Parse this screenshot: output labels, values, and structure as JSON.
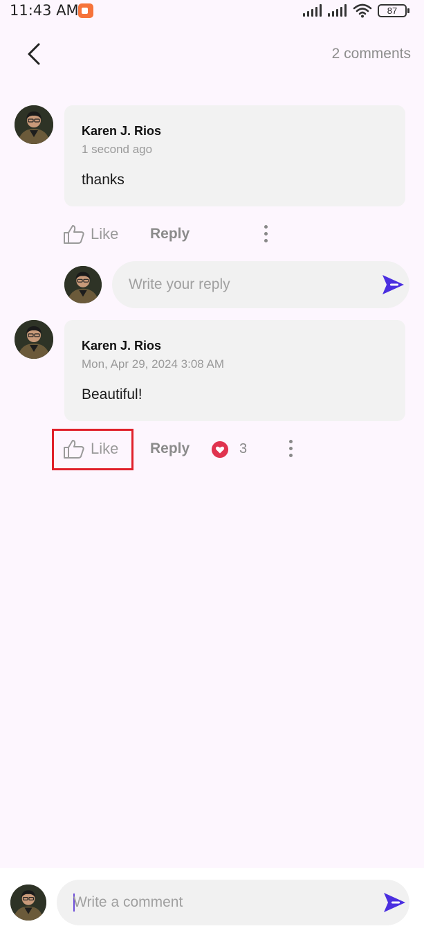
{
  "status_bar": {
    "time": "11:43 AM",
    "battery": "87",
    "icons": [
      "screen-record-icon",
      "signal-icon",
      "signal-icon",
      "wifi-icon",
      "battery-icon"
    ]
  },
  "header": {
    "comment_count": "2 comments"
  },
  "comments": [
    {
      "author": "Karen J. Rios",
      "time": "1 second ago",
      "text": "thanks",
      "like_label": "Like",
      "reply_label": "Reply"
    },
    {
      "author": "Karen J. Rios",
      "time": "Mon, Apr 29, 2024 3:08 AM",
      "text": "Beautiful!",
      "like_label": "Like",
      "reply_label": "Reply",
      "reaction_count": "3"
    }
  ],
  "reply_input": {
    "placeholder": "Write your reply"
  },
  "comment_input": {
    "placeholder": "Write a comment"
  },
  "colors": {
    "accent": "#4b2fe0",
    "highlight": "#e0202a",
    "heart": "#e0344f"
  }
}
